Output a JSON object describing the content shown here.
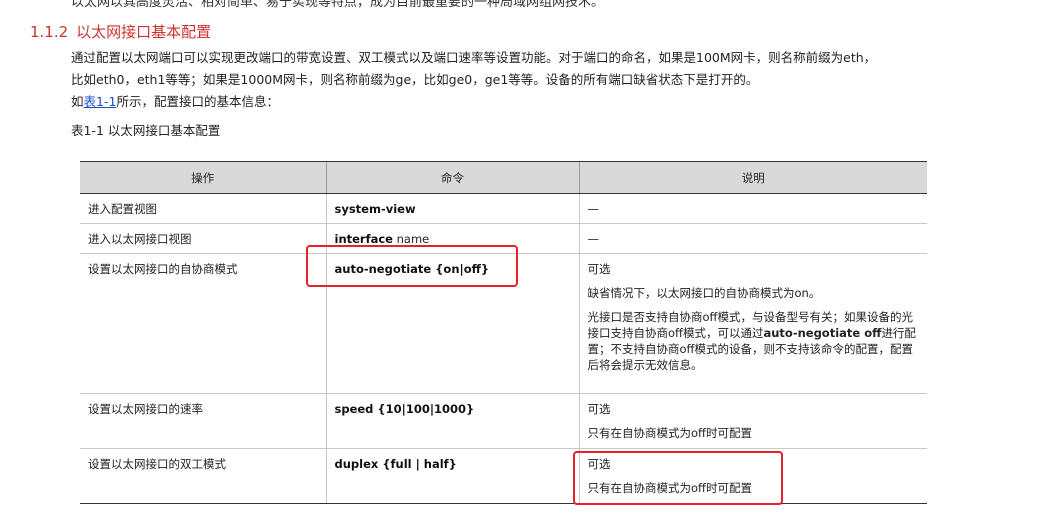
{
  "intro_cut": "以太网以其高度灵活、相对简单、易于实现等特点，成为目前最重要的一种局域网组网技术。",
  "section": {
    "number": "1.1.2",
    "title": "以太网接口基本配置"
  },
  "paragraph": {
    "line1": "通过配置以太网端口可以实现更改端口的带宽设置、双工模式以及端口速率等设置功能。对于端口的命名，如果是100M网卡，则名称前缀为eth，",
    "line2": "比如eth0，eth1等等；如果是1000M网卡，则名称前缀为ge，比如ge0，ge1等等。设备的所有端口缺省状态下是打开的。",
    "line3_pre": "如",
    "line3_link": "表1-1",
    "line3_post": "所示，配置接口的基本信息："
  },
  "table_caption": "表1-1 以太网接口基本配置",
  "table": {
    "headers": [
      "操作",
      "命令",
      "说明"
    ],
    "rows": [
      {
        "op": "进入配置视图",
        "cmd": "system-view",
        "cmd_arg": "",
        "desc": [
          "—"
        ]
      },
      {
        "op": "进入以太网接口视图",
        "cmd": "interface",
        "cmd_arg": " name",
        "desc": [
          "—"
        ]
      },
      {
        "op": "设置以太网接口的自协商模式",
        "cmd": "auto-negotiate",
        "cmd_arg": " {on|off}",
        "desc": [
          "可选",
          "缺省情况下，以太网接口的自协商模式为on。"
        ],
        "desc_rich": {
          "pre": "光接口是否支持自协商off模式，与设备型号有关；如果设备的光接口支持自协商off模式，可以通过",
          "bold": "auto-negotiate off",
          "post": "进行配置；不支持自协商off模式的设备，则不支持该命令的配置，配置后将会提示无效信息。"
        }
      },
      {
        "op": "设置以太网接口的速率",
        "cmd": "speed",
        "cmd_arg": " {10|100|1000}",
        "desc": [
          "可选",
          "只有在自协商模式为off时可配置"
        ]
      },
      {
        "op": "设置以太网接口的双工模式",
        "cmd": "duplex",
        "cmd_arg": " {full | half}",
        "desc": [
          "可选",
          "只有在自协商模式为off时可配置"
        ]
      }
    ]
  },
  "colors": {
    "heading": "#cc3333",
    "link": "#1a4fd0",
    "highlight": "#e8202a",
    "header_bg": "#d9d9d9"
  }
}
